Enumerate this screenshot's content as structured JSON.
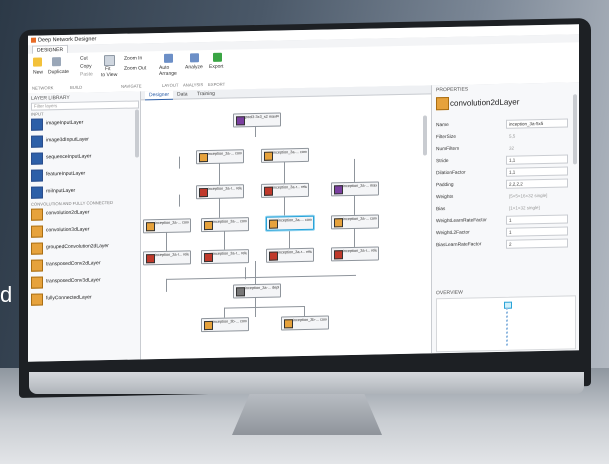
{
  "app": {
    "title": "Deep Network Designer",
    "ribbon_tab": "DESIGNER"
  },
  "background": {
    "partial_text": "d"
  },
  "ribbon": {
    "new": "New",
    "duplicate": "Duplicate",
    "cut": "Cut",
    "copy": "Copy",
    "paste": "Paste",
    "fit": "Fit",
    "to_view": "to View",
    "zoom_in": "Zoom In",
    "zoom_out": "Zoom Out",
    "auto_arrange": "Auto Arrange",
    "analyze": "Analyze",
    "export": "Export",
    "groups": {
      "network": "NETWORK",
      "build": "BUILD",
      "navigate": "NAVIGATE",
      "layout": "LAYOUT",
      "analysis": "ANALYSIS",
      "export": "EXPORT"
    }
  },
  "layer_library": {
    "header": "LAYER LIBRARY",
    "filter_placeholder": "Filter layers",
    "input_section": "INPUT",
    "conv_section": "CONVOLUTION AND FULLY CONNECTED",
    "input_items": [
      "imageInputLayer",
      "image3dInputLayer",
      "sequenceInputLayer",
      "featureInputLayer",
      "roiInputLayer"
    ],
    "conv_items": [
      "convolution2dLayer",
      "convolution3dLayer",
      "groupedConvolution2dLayer",
      "transposedConv2dLayer",
      "transposedConv3dLayer",
      "fullyConnectedLayer"
    ]
  },
  "canvas": {
    "tabs": [
      "Designer",
      "Data",
      "Training"
    ],
    "nodes": {
      "pool": "pool3-3x3_s2 maxPooling2D...",
      "i1": "inception_3a-... convolution2D...",
      "i2": "inception_3a-... convolution2D...",
      "i3": "inception_3a-... maxPooling2D...",
      "r1": "inception_3a-r... reluLayer",
      "r2": "inception_3a-r... reluLayer",
      "c1": "inception_3a-... convolution2D...",
      "c2": "inception_3a-... convolution2D...",
      "c3": "inception_3a-... convolution2D...",
      "c4": "inception_3a-... convolution2D...",
      "c5": "inception_3a-... convolution2D...",
      "rl1": "inception_3a-r... reluLayer",
      "rl2": "inception_3a-r... reluLayer",
      "rl3": "inception_3a-r... reluLayer",
      "rl4": "inception_3a-r... reluLayer",
      "rl5": "inception_3a-r... reluLayer",
      "concat": "inception_3a-... depthConcaten...",
      "b1": "inception_3b-... convolution2D...",
      "b2": "inception_3b-... convolution2D..."
    }
  },
  "properties": {
    "header": "PROPERTIES",
    "layer_type": "convolution2dLayer",
    "rows": [
      {
        "key": "Name",
        "value": "inception_3a-5x5",
        "editable": true
      },
      {
        "key": "FilterSize",
        "value": "5,5",
        "editable": false
      },
      {
        "key": "NumFilters",
        "value": "32",
        "editable": false
      },
      {
        "key": "Stride",
        "value": "1,1",
        "editable": true
      },
      {
        "key": "DilationFactor",
        "value": "1,1",
        "editable": true
      },
      {
        "key": "Padding",
        "value": "2,2,2,2",
        "editable": true
      },
      {
        "key": "Weights",
        "value": "[5×5×16×32 single]",
        "editable": false
      },
      {
        "key": "Bias",
        "value": "[1×1×32 single]",
        "editable": false
      },
      {
        "key": "WeightLearnRateFactor",
        "value": "1",
        "editable": true
      },
      {
        "key": "WeightL2Factor",
        "value": "1",
        "editable": true
      },
      {
        "key": "BiasLearnRateFactor",
        "value": "2",
        "editable": true
      }
    ],
    "overview": "OVERVIEW"
  },
  "colors": {
    "accent": "#2d5fa8",
    "selection": "#2aa3d8",
    "orange_layer": "#e6a23c",
    "relu_red": "#c0392b",
    "pool_purple": "#7b3fa0"
  }
}
